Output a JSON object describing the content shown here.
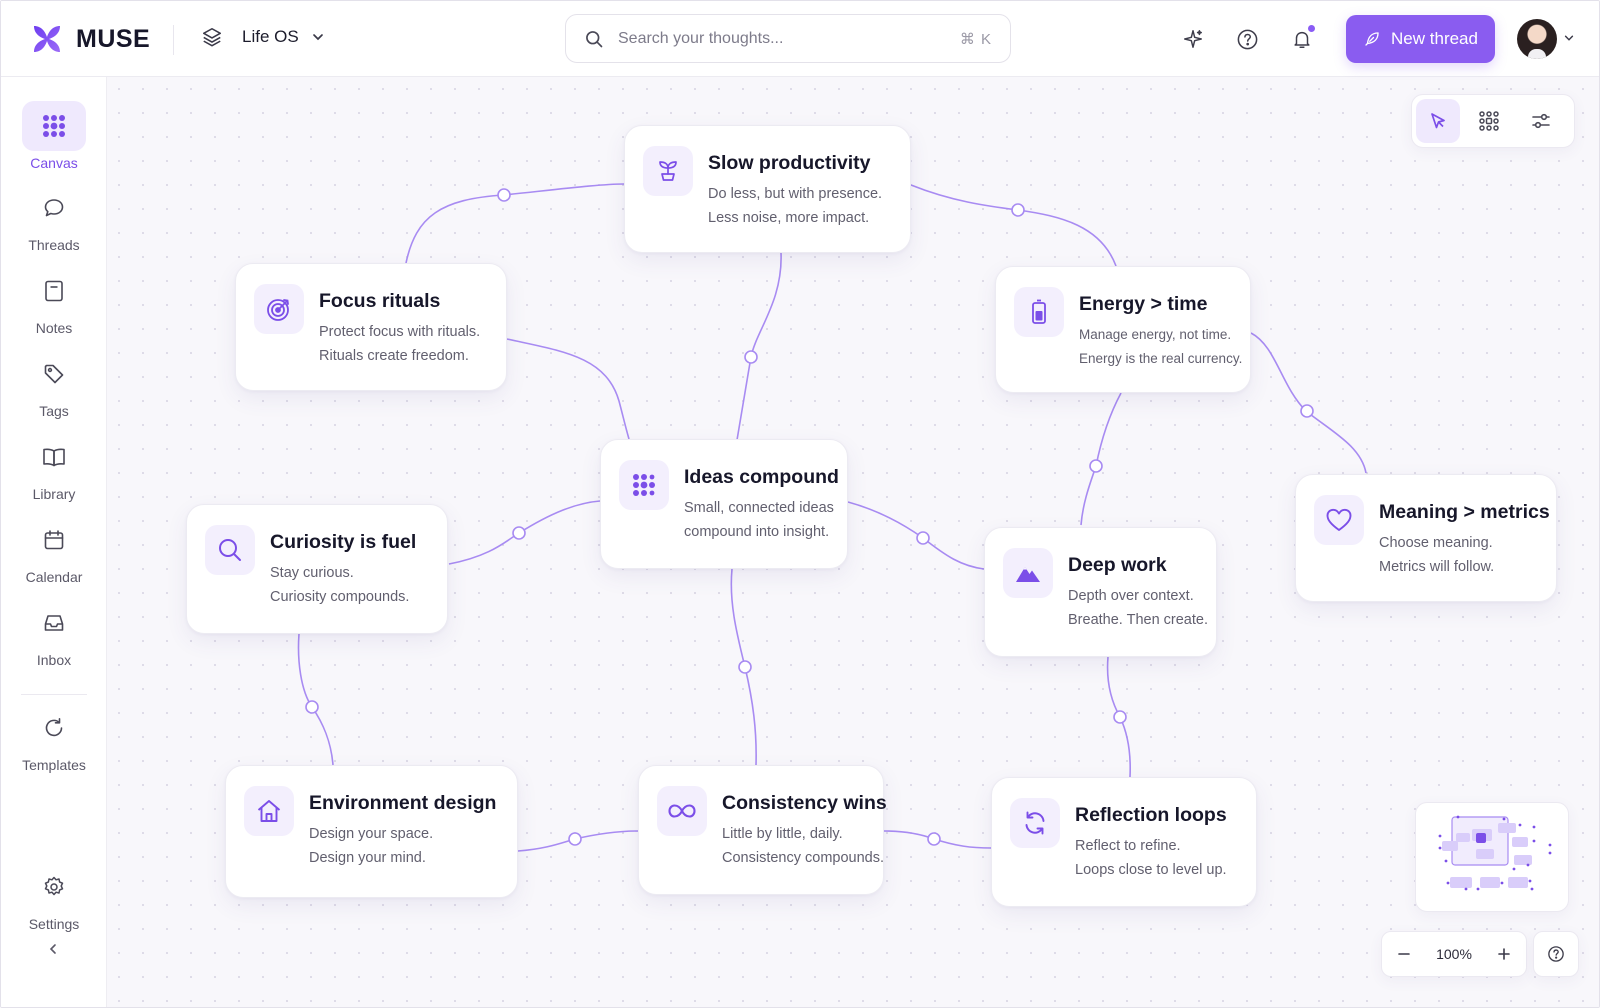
{
  "app": {
    "name": "MUSE",
    "workspace": "Life OS"
  },
  "search": {
    "placeholder": "Search your thoughts...",
    "shortcut": "⌘ K"
  },
  "header": {
    "new_thread_label": "New thread"
  },
  "sidebar": {
    "items": [
      {
        "label": "Canvas",
        "icon": "canvas-icon",
        "active": true
      },
      {
        "label": "Threads",
        "icon": "chat-bubble-icon"
      },
      {
        "label": "Notes",
        "icon": "note-icon"
      },
      {
        "label": "Tags",
        "icon": "tag-icon"
      },
      {
        "label": "Library",
        "icon": "book-icon"
      },
      {
        "label": "Calendar",
        "icon": "calendar-icon"
      },
      {
        "label": "Inbox",
        "icon": "inbox-icon"
      },
      {
        "label": "Templates",
        "icon": "refresh-icon"
      },
      {
        "label": "Settings",
        "icon": "gear-icon"
      }
    ]
  },
  "cards": [
    {
      "id": "slow",
      "title": "Slow productivity",
      "line1": "Do less, but with presence.",
      "line2": "Less noise, more impact.",
      "icon": "sprout-icon"
    },
    {
      "id": "focus",
      "title": "Focus rituals",
      "line1": "Protect focus with rituals.",
      "line2": "Rituals create freedom.",
      "icon": "target-icon"
    },
    {
      "id": "energy",
      "title": "Energy > time",
      "line1": "Manage energy, not time.",
      "line2": "Energy is the real currency.",
      "icon": "battery-icon"
    },
    {
      "id": "ideas",
      "title": "Ideas compound",
      "line1": "Small, connected ideas",
      "line2": "compound into insight.",
      "icon": "dots-grid-icon"
    },
    {
      "id": "curiosity",
      "title": "Curiosity is fuel",
      "line1": "Stay curious.",
      "line2": "Curiosity compounds.",
      "icon": "search-icon"
    },
    {
      "id": "deep",
      "title": "Deep work",
      "line1": "Depth over context.",
      "line2": "Breathe. Then create.",
      "icon": "mountain-icon"
    },
    {
      "id": "meaning",
      "title": "Meaning > metrics",
      "line1": "Choose meaning.",
      "line2": "Metrics will follow.",
      "icon": "heart-icon"
    },
    {
      "id": "environment",
      "title": "Environment design",
      "line1": "Design your space.",
      "line2": "Design your mind.",
      "icon": "home-icon"
    },
    {
      "id": "consistency",
      "title": "Consistency wins",
      "line1": "Little by little, daily.",
      "line2": "Consistency compounds.",
      "icon": "infinity-icon"
    },
    {
      "id": "reflection",
      "title": "Reflection loops",
      "line1": "Reflect to refine.",
      "line2": "Loops close to level up.",
      "icon": "refresh-icon"
    }
  ],
  "zoom": {
    "level": "100%"
  },
  "colors": {
    "accent": "#8a5cf0",
    "accent_soft": "#efe9fd",
    "link": "#a88bf2"
  }
}
